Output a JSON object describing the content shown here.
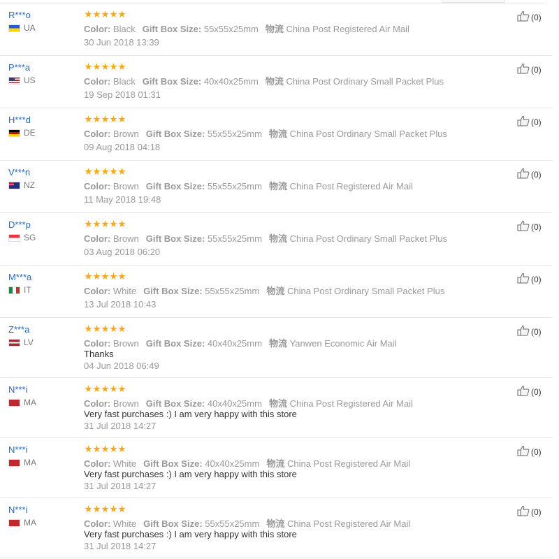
{
  "labels": {
    "color": "Color:",
    "gift_box_size": "Gift Box Size:",
    "logistics": "物流"
  },
  "reviews": [
    {
      "name": "R***o",
      "flag": "ua",
      "country": "UA",
      "color": "Black",
      "size": "55x55x25mm",
      "shipping": "China Post Registered Air Mail",
      "comment": "",
      "date": "30 Jun 2018 13:39",
      "helpful": "(0)"
    },
    {
      "name": "P***a",
      "flag": "us",
      "country": "US",
      "color": "Black",
      "size": "40x40x25mm",
      "shipping": "China Post Ordinary Small Packet Plus",
      "comment": "",
      "date": "19 Sep 2018 01:31",
      "helpful": "(0)"
    },
    {
      "name": "H***d",
      "flag": "de",
      "country": "DE",
      "color": "Brown",
      "size": "55x55x25mm",
      "shipping": "China Post Ordinary Small Packet Plus",
      "comment": "",
      "date": "09 Aug 2018 04:18",
      "helpful": "(0)"
    },
    {
      "name": "V***n",
      "flag": "nz",
      "country": "NZ",
      "color": "Brown",
      "size": "55x55x25mm",
      "shipping": "China Post Registered Air Mail",
      "comment": "",
      "date": "11 May 2018 19:48",
      "helpful": "(0)"
    },
    {
      "name": "D***p",
      "flag": "sg",
      "country": "SG",
      "color": "Brown",
      "size": "55x55x25mm",
      "shipping": "China Post Ordinary Small Packet Plus",
      "comment": "",
      "date": "03 Aug 2018 06:20",
      "helpful": "(0)"
    },
    {
      "name": "M***a",
      "flag": "it",
      "country": "IT",
      "color": "White",
      "size": "55x55x25mm",
      "shipping": "China Post Ordinary Small Packet Plus",
      "comment": "",
      "date": "13 Jul 2018 10:43",
      "helpful": "(0)"
    },
    {
      "name": "Z***a",
      "flag": "lv",
      "country": "LV",
      "color": "Brown",
      "size": "40x40x25mm",
      "shipping": "Yanwen Economic Air Mail",
      "comment": "Thanks",
      "date": "04 Jun 2018 06:49",
      "helpful": "(0)"
    },
    {
      "name": "N***i",
      "flag": "ma",
      "country": "MA",
      "color": "Brown",
      "size": "40x40x25mm",
      "shipping": "China Post Registered Air Mail",
      "comment": "Very fast purchases :) I am very happy with this store",
      "date": "31 Jul 2018 14:27",
      "helpful": "(0)"
    },
    {
      "name": "N***i",
      "flag": "ma",
      "country": "MA",
      "color": "White",
      "size": "40x40x25mm",
      "shipping": "China Post Registered Air Mail",
      "comment": "Very fast purchases :) I am very happy with this store",
      "date": "31 Jul 2018 14:27",
      "helpful": "(0)"
    },
    {
      "name": "N***i",
      "flag": "ma",
      "country": "MA",
      "color": "White",
      "size": "55x55x25mm",
      "shipping": "China Post Registered Air Mail",
      "comment": "Very fast purchases :) I am very happy with this store",
      "date": "31 Jul 2018 14:27",
      "helpful": "(0)"
    }
  ]
}
